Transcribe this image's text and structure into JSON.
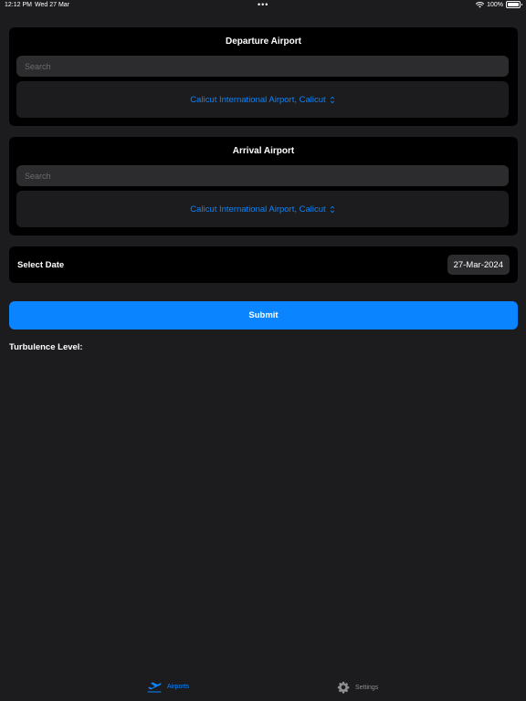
{
  "status_bar": {
    "time": "12:12 PM",
    "date": "Wed 27 Mar",
    "dots": "•••",
    "battery": "100%"
  },
  "departure": {
    "title": "Departure Airport",
    "search_placeholder": "Search",
    "selected_airport": "Calicut International Airport, Calicut",
    "chevron": "⌃⌄"
  },
  "arrival": {
    "title": "Arrival Airport",
    "search_placeholder": "Search",
    "selected_airport": "Calicut International Airport, Calicut",
    "chevron": "⌃⌄"
  },
  "date_select": {
    "label": "Select Date",
    "value": "27-Mar-2024"
  },
  "submit_label": "Submit",
  "turbulence_label": "Turbulence Level:",
  "tab_bar": {
    "tabs": [
      {
        "label": "Airports",
        "icon": "airplane-departure-icon",
        "selected": true
      },
      {
        "label": "Settings",
        "icon": "gear-icon",
        "selected": false
      }
    ]
  },
  "colors": {
    "accent": "#0a84ff",
    "background": "#1c1c1e",
    "card": "#000000",
    "field": "#2c2c2e",
    "inactive_tab": "#8e8e93"
  }
}
